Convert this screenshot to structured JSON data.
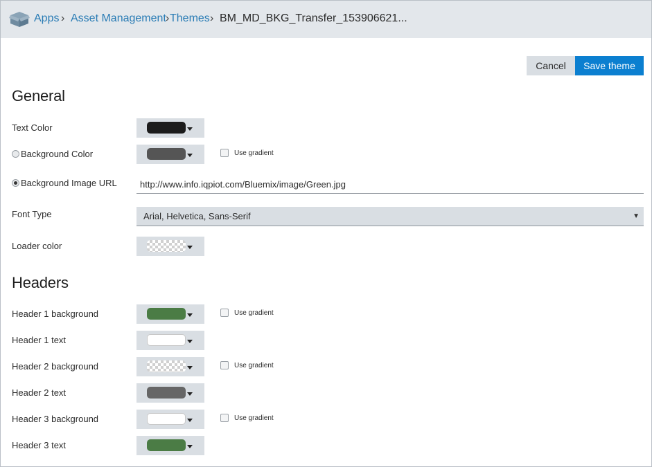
{
  "breadcrumb": {
    "items": [
      "Apps",
      "Asset Management",
      "Themes"
    ],
    "current": "BM_MD_BKG_Transfer_153906621..."
  },
  "toolbar": {
    "cancel_label": "Cancel",
    "save_label": "Save theme"
  },
  "general": {
    "title": "General",
    "text_color": {
      "label": "Text Color",
      "color": "#1c1c1c"
    },
    "background_color": {
      "label": "Background Color",
      "color": "#555555",
      "selected": false,
      "gradient_label": "Use gradient",
      "gradient_checked": false
    },
    "background_image": {
      "label": "Background Image URL",
      "selected": true,
      "value": "http://www.info.iqpiot.com/Bluemix/image/Green.jpg"
    },
    "font_type": {
      "label": "Font Type",
      "value": "Arial, Helvetica, Sans-Serif"
    },
    "loader_color": {
      "label": "Loader color",
      "color": "transparent"
    }
  },
  "headers": {
    "title": "Headers",
    "rows": [
      {
        "label": "Header 1 background",
        "color": "#4b7c45",
        "gradient_label": "Use gradient",
        "gradient_checked": false
      },
      {
        "label": "Header 1 text",
        "color": "#ffffff"
      },
      {
        "label": "Header 2 background",
        "color": "transparent",
        "gradient_label": "Use gradient",
        "gradient_checked": false
      },
      {
        "label": "Header 2 text",
        "color": "#666666"
      },
      {
        "label": "Header 3 background",
        "color": "#ffffff",
        "gradient_label": "Use gradient",
        "gradient_checked": false
      },
      {
        "label": "Header 3 text",
        "color": "#4b7c45"
      }
    ]
  },
  "icons": {
    "apps": "box-icon",
    "caret": "caret-down-icon",
    "select_arrow": "triangle-down-icon"
  }
}
